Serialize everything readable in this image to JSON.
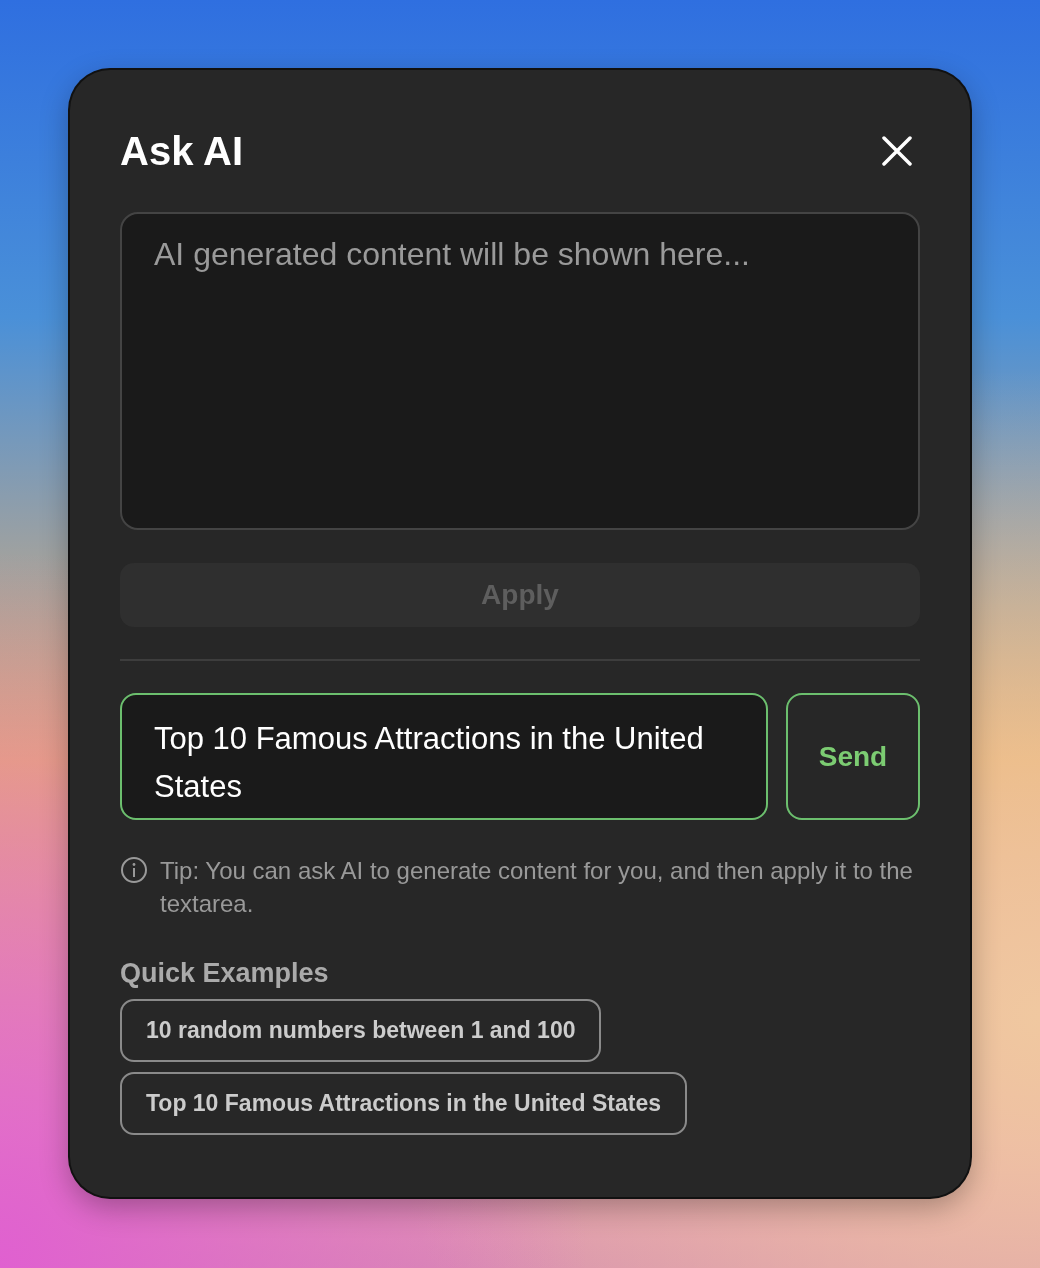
{
  "dialog": {
    "title": "Ask AI"
  },
  "output_area": {
    "placeholder": "AI generated content will be shown here..."
  },
  "apply_button": {
    "label": "Apply",
    "disabled": true
  },
  "prompt_field": {
    "value": "Top 10 Famous Attractions in the United States"
  },
  "send_button": {
    "label": "Send"
  },
  "tip": "Tip: You can ask AI to generate content for you, and then apply it to the textarea.",
  "quick_examples": {
    "heading": "Quick Examples",
    "items": [
      {
        "label": "10 random numbers between 1 and 100"
      },
      {
        "label": "Top 10 Famous Attractions in the United States"
      }
    ]
  }
}
